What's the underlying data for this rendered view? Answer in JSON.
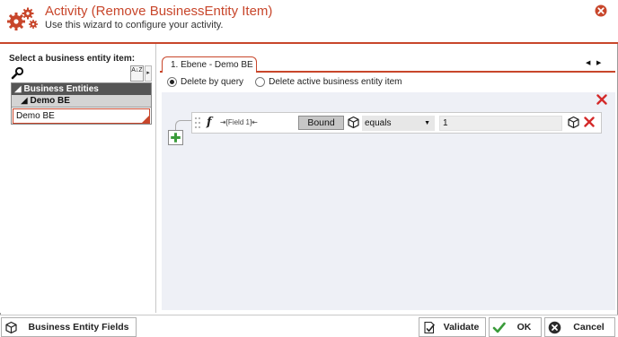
{
  "window": {
    "title": "Activity (Remove BusinessEntity Item)",
    "subtitle": "Use this wizard to configure your activity."
  },
  "left": {
    "label": "Select a business entity item:",
    "sort_icon_text": "A↓Z",
    "tree": {
      "root": "Business Entities",
      "child": "Demo BE",
      "item": "Demo BE"
    }
  },
  "tabs": [
    {
      "label": "1. Ebene - Demo BE"
    }
  ],
  "options": {
    "delete_by_query": "Delete by query",
    "delete_active": "Delete active business entity item",
    "selected": "delete_by_query"
  },
  "condition": {
    "func_symbol": "f",
    "field_chip": "⇥[Field 1]⇤",
    "bound_label": "Bound",
    "operator": "equals",
    "value": "1"
  },
  "footer": {
    "business_entity_fields": "Business Entity Fields",
    "validate": "Validate",
    "ok": "OK",
    "cancel": "Cancel"
  },
  "colors": {
    "accent": "#c8462b",
    "tree_root_bg": "#555555",
    "query_area_bg": "#eef0f6",
    "ok_check": "#3a9b3a",
    "remove_red": "#d42a2a"
  },
  "icons": [
    "gears-icon",
    "close-icon",
    "search-icon",
    "sort-az-icon",
    "cube-icon",
    "add-icon",
    "remove-icon",
    "validate-icon",
    "check-icon",
    "cancel-icon"
  ]
}
